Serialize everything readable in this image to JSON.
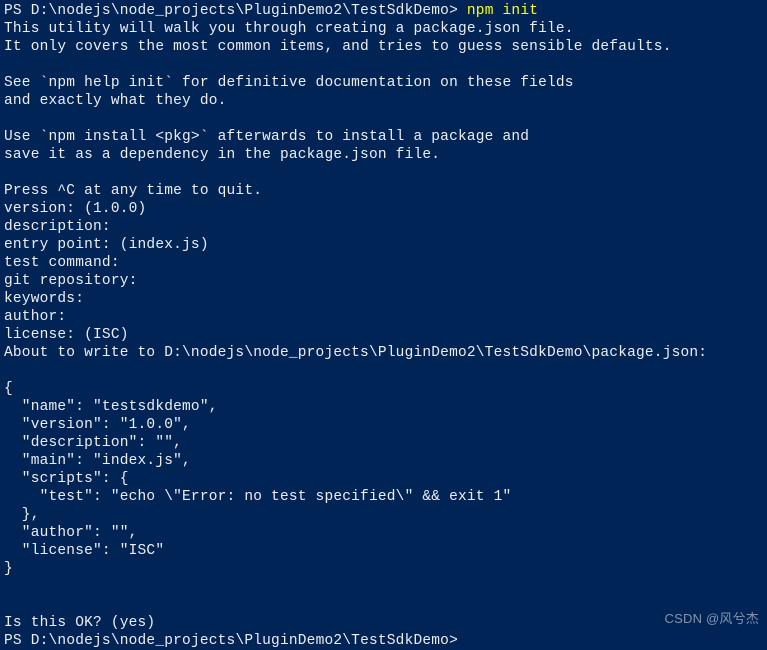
{
  "terminal": {
    "prompt_prefix": "PS ",
    "path": "D:\\nodejs\\node_projects\\PluginDemo2\\TestSdkDemo",
    "prompt_suffix": "> ",
    "command": "npm init",
    "lines": {
      "l1": "This utility will walk you through creating a package.json file.",
      "l2": "It only covers the most common items, and tries to guess sensible defaults.",
      "l3": "",
      "l4": "See `npm help init` for definitive documentation on these fields",
      "l5": "and exactly what they do.",
      "l6": "",
      "l7": "Use `npm install <pkg>` afterwards to install a package and",
      "l8": "save it as a dependency in the package.json file.",
      "l9": "",
      "l10": "Press ^C at any time to quit.",
      "l11": "version: (1.0.0)",
      "l12": "description:",
      "l13": "entry point: (index.js)",
      "l14": "test command:",
      "l15": "git repository:",
      "l16": "keywords:",
      "l17": "author:",
      "l18": "license: (ISC)",
      "l19": "About to write to D:\\nodejs\\node_projects\\PluginDemo2\\TestSdkDemo\\package.json:",
      "l20": "",
      "l21": "{",
      "l22": "  \"name\": \"testsdkdemo\",",
      "l23": "  \"version\": \"1.0.0\",",
      "l24": "  \"description\": \"\",",
      "l25": "  \"main\": \"index.js\",",
      "l26": "  \"scripts\": {",
      "l27": "    \"test\": \"echo \\\"Error: no test specified\\\" && exit 1\"",
      "l28": "  },",
      "l29": "  \"author\": \"\",",
      "l30": "  \"license\": \"ISC\"",
      "l31": "}",
      "l32": "",
      "l33": "",
      "l34": "Is this OK? (yes)"
    },
    "prompt2_prefix": "PS ",
    "prompt2_path": "D:\\nodejs\\node_projects\\PluginDemo2\\TestSdkDemo",
    "prompt2_suffix": ">"
  },
  "watermark": "CSDN @风兮杰"
}
